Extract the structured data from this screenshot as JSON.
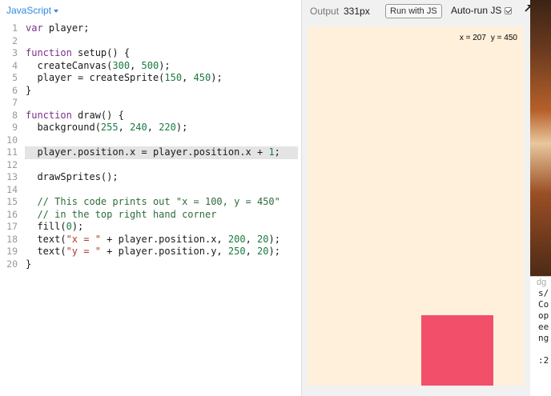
{
  "editor": {
    "language_label": "JavaScript",
    "lines": [
      {
        "n": "1",
        "tokens": [
          [
            "kw",
            "var"
          ],
          [
            "",
            "player;"
          ]
        ]
      },
      {
        "n": "2",
        "tokens": []
      },
      {
        "n": "3",
        "tokens": [
          [
            "kw",
            "function"
          ],
          [
            "",
            "setup() {"
          ]
        ]
      },
      {
        "n": "4",
        "tokens": [
          [
            "",
            "  createCanvas("
          ],
          [
            "num",
            "300"
          ],
          [
            "",
            ", "
          ],
          [
            "num",
            "500"
          ],
          [
            "",
            ");"
          ]
        ]
      },
      {
        "n": "5",
        "tokens": [
          [
            "",
            "  player = createSprite("
          ],
          [
            "num",
            "150"
          ],
          [
            "",
            ", "
          ],
          [
            "num",
            "450"
          ],
          [
            "",
            ");"
          ]
        ]
      },
      {
        "n": "6",
        "tokens": [
          [
            "",
            "}"
          ]
        ]
      },
      {
        "n": "7",
        "tokens": []
      },
      {
        "n": "8",
        "tokens": [
          [
            "kw",
            "function"
          ],
          [
            "",
            "draw() {"
          ]
        ]
      },
      {
        "n": "9",
        "tokens": [
          [
            "",
            "  background("
          ],
          [
            "num",
            "255"
          ],
          [
            "",
            ", "
          ],
          [
            "num",
            "240"
          ],
          [
            "",
            ", "
          ],
          [
            "num",
            "220"
          ],
          [
            "",
            ");"
          ]
        ]
      },
      {
        "n": "10",
        "tokens": []
      },
      {
        "n": "11",
        "active": true,
        "tokens": [
          [
            "",
            "  player.position.x = player.position.x + "
          ],
          [
            "num",
            "1"
          ],
          [
            "",
            ";"
          ]
        ]
      },
      {
        "n": "12",
        "tokens": []
      },
      {
        "n": "13",
        "tokens": [
          [
            "",
            "  drawSprites();"
          ]
        ]
      },
      {
        "n": "14",
        "tokens": []
      },
      {
        "n": "15",
        "tokens": [
          [
            "cm",
            "  // This code prints out \"x = 100, y = 450\""
          ]
        ]
      },
      {
        "n": "16",
        "tokens": [
          [
            "cm",
            "  // in the top right hand corner"
          ]
        ]
      },
      {
        "n": "17",
        "tokens": [
          [
            "",
            "  fill("
          ],
          [
            "num",
            "0"
          ],
          [
            "",
            ");"
          ]
        ]
      },
      {
        "n": "18",
        "tokens": [
          [
            "",
            "  text("
          ],
          [
            "str",
            "\"x = \""
          ],
          [
            "",
            " + player.position.x, "
          ],
          [
            "num",
            "200"
          ],
          [
            "",
            ", "
          ],
          [
            "num",
            "20"
          ],
          [
            "",
            ");"
          ]
        ]
      },
      {
        "n": "19",
        "tokens": [
          [
            "",
            "  text("
          ],
          [
            "str",
            "\"y = \""
          ],
          [
            "",
            " + player.position.y, "
          ],
          [
            "num",
            "250"
          ],
          [
            "",
            ", "
          ],
          [
            "num",
            "20"
          ],
          [
            "",
            ");"
          ]
        ]
      },
      {
        "n": "20",
        "tokens": [
          [
            "",
            "}"
          ]
        ]
      }
    ]
  },
  "output": {
    "label": "Output",
    "size": "331px",
    "run_button": "Run with JS",
    "autorun_label": "Auto-run JS",
    "autorun_checked": true,
    "popout_icon": "external-arrow-icon"
  },
  "canvas": {
    "background": "#fff0dc",
    "x_text": "x = 207",
    "y_text": "y = 450",
    "sprite_color": "#f24f6b"
  },
  "edge_panel": {
    "top": "dg",
    "lines": [
      "s/",
      "Co",
      "op",
      "ee",
      "ng",
      "",
      ":2"
    ]
  },
  "colors": {
    "accent": "#2e8ae6",
    "keyword": "#7a2f8a",
    "number": "#1a7a40",
    "string": "#b03a28",
    "comment": "#2e6b3a"
  }
}
